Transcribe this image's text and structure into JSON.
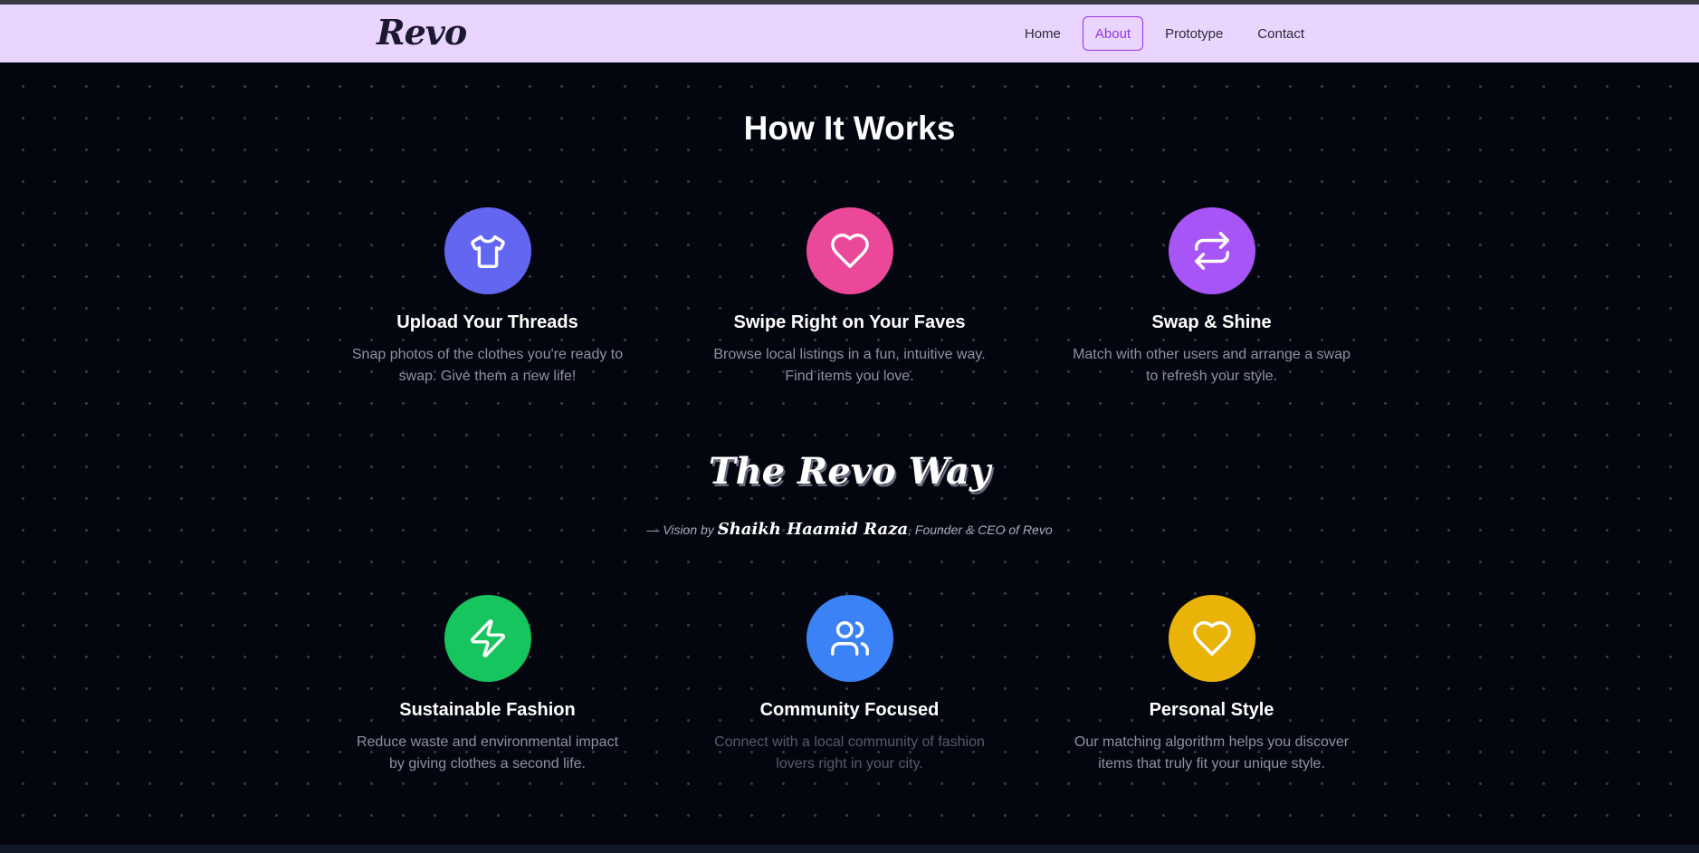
{
  "brand": {
    "logo_text": "Revo"
  },
  "nav": {
    "items": [
      {
        "label": "Home",
        "active": false
      },
      {
        "label": "About",
        "active": true
      },
      {
        "label": "Prototype",
        "active": false
      },
      {
        "label": "Contact",
        "active": false
      }
    ]
  },
  "how_it_works": {
    "title": "How It Works",
    "steps": [
      {
        "icon": "shirt-icon",
        "color": "#6366f1",
        "title": "Upload Your Threads",
        "description": "Snap photos of the clothes you're ready to swap. Give them a new life!"
      },
      {
        "icon": "heart-icon",
        "color": "#ec4899",
        "title": "Swipe Right on Your Faves",
        "description": "Browse local listings in a fun, intuitive way. Find items you love."
      },
      {
        "icon": "repeat-icon",
        "color": "#a855f7",
        "title": "Swap & Shine",
        "description": "Match with other users and arrange a swap to refresh your style."
      }
    ]
  },
  "revo_way": {
    "title": "The Revo Way",
    "vision_prefix": "— Vision by ",
    "founder_name": "Shaikh Haamid Raza",
    "vision_suffix": ", Founder & CEO of Revo",
    "values": [
      {
        "icon": "lightning-icon",
        "color": "#16c55e",
        "title": "Sustainable Fashion",
        "description": "Reduce waste and environmental impact by giving clothes a second life."
      },
      {
        "icon": "users-icon",
        "color": "#3b82f6",
        "title": "Community Focused",
        "description": "Connect with a local community of fashion lovers right in your city."
      },
      {
        "icon": "heart-icon",
        "color": "#eab308",
        "title": "Personal Style",
        "description": "Our matching algorithm helps you discover items that truly fit your unique style."
      }
    ]
  }
}
